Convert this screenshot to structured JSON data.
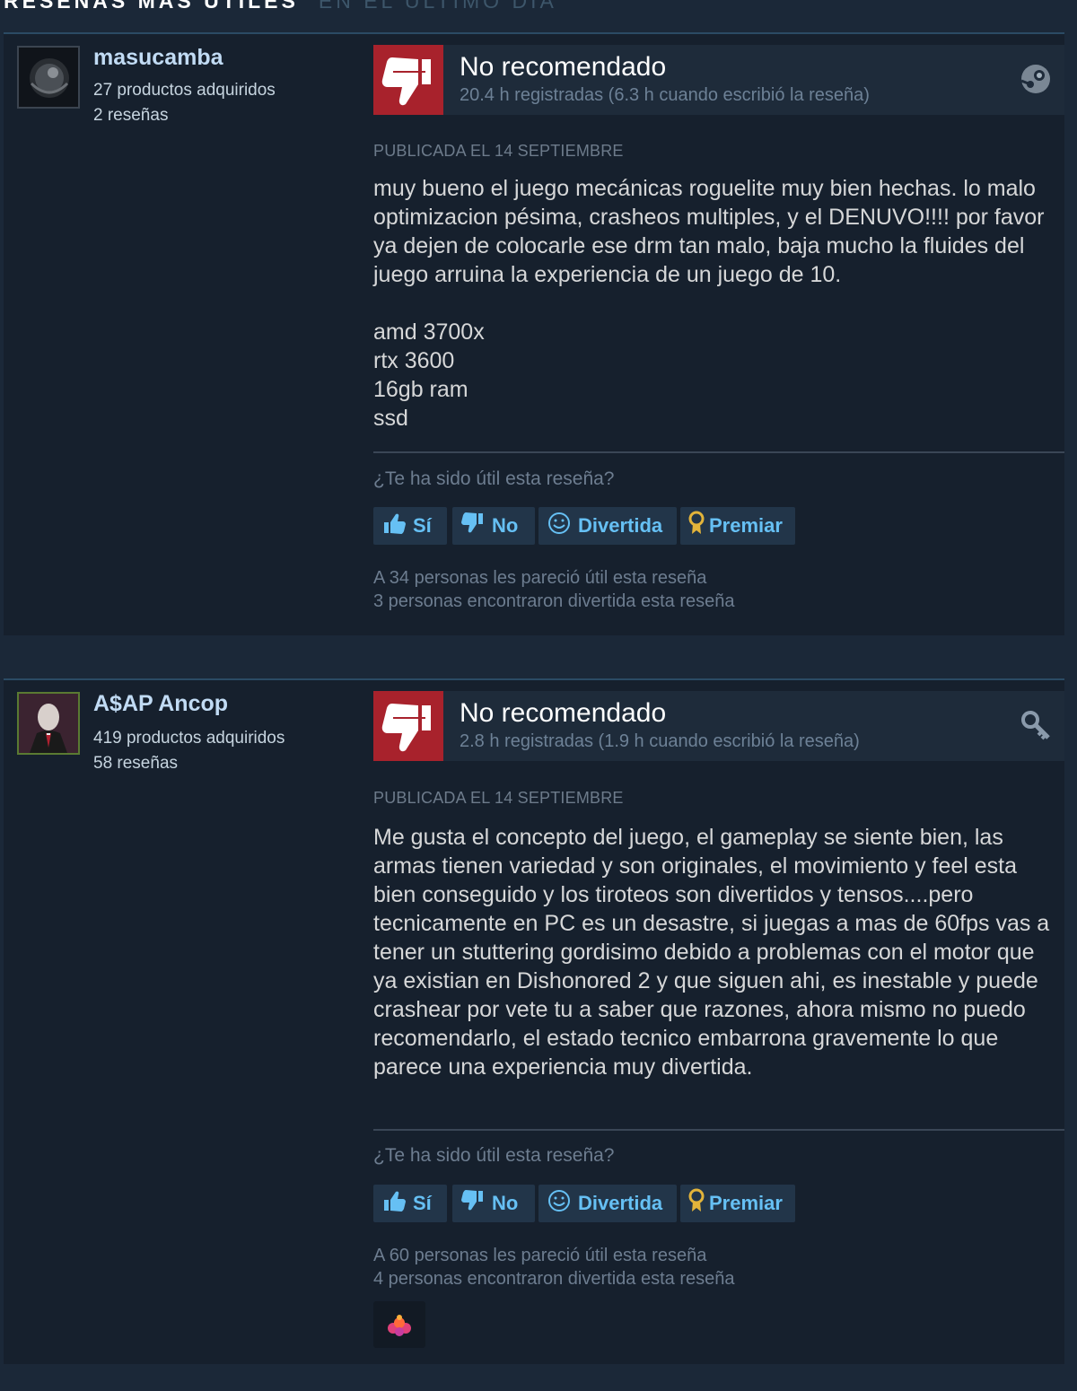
{
  "section": {
    "title": "RESEÑAS MÁS ÚTILES",
    "subtitle": "EN EL ÚLTIMO DÍA"
  },
  "colors": {
    "background": "#1b2838",
    "review_bg": "#16202d",
    "not_recommended": "#a8222c",
    "button_text": "#66c0f4",
    "award_gold": "#e3b43a"
  },
  "reviews": [
    {
      "author": "masucamba",
      "products": "27 productos adquiridos",
      "reviews_count": "2 reseñas",
      "verdict": "No recomendado",
      "hours": "20.4 h registradas (6.3 h cuando escribió la reseña)",
      "corner_icon": "steam-icon",
      "posted": "PUBLICADA EL 14 SEPTIEMBRE",
      "body": "muy bueno el juego mecánicas roguelite muy bien hechas. lo malo optimizacion pésima, crasheos multiples, y el DENUVO!!!! por favor ya dejen de colocarle ese drm tan malo, baja mucho la fluides del juego arruina la experiencia de un juego de 10.",
      "specs": [
        "amd 3700x",
        "rtx 3600",
        "16gb ram",
        "ssd"
      ],
      "helpful_question": "¿Te ha sido útil esta reseña?",
      "buttons": {
        "yes": "Sí",
        "no": "No",
        "funny": "Divertida",
        "award": "Premiar"
      },
      "helpful_stat": "A 34 personas les pareció útil esta reseña",
      "funny_stat": "3 personas encontraron divertida esta reseña"
    },
    {
      "author": "A$AP Ancop",
      "products": "419 productos adquiridos",
      "reviews_count": "58 reseñas",
      "verdict": "No recomendado",
      "hours": "2.8 h registradas (1.9 h cuando escribió la reseña)",
      "corner_icon": "key-icon",
      "posted": "PUBLICADA EL 14 SEPTIEMBRE",
      "body": "Me gusta el concepto del juego, el gameplay se siente bien, las armas tienen variedad y son originales, el movimiento y feel esta bien conseguido y los tiroteos son divertidos y tensos....pero tecnicamente en PC es un desastre, si juegas a mas de 60fps vas a tener un stuttering gordisimo debido a problemas con el motor que ya existian en Dishonored 2 y que siguen ahi, es inestable y puede crashear por vete tu a saber que razones, ahora mismo no puedo recomendarlo, el estado tecnico embarrona gravemente lo que parece una experiencia muy divertida.",
      "helpful_question": "¿Te ha sido útil esta reseña?",
      "buttons": {
        "yes": "Sí",
        "no": "No",
        "funny": "Divertida",
        "award": "Premiar"
      },
      "helpful_stat": "A 60 personas les pareció útil esta reseña",
      "funny_stat": "4 personas encontraron divertida esta reseña",
      "award_icon": "award-reaction-icon"
    }
  ]
}
